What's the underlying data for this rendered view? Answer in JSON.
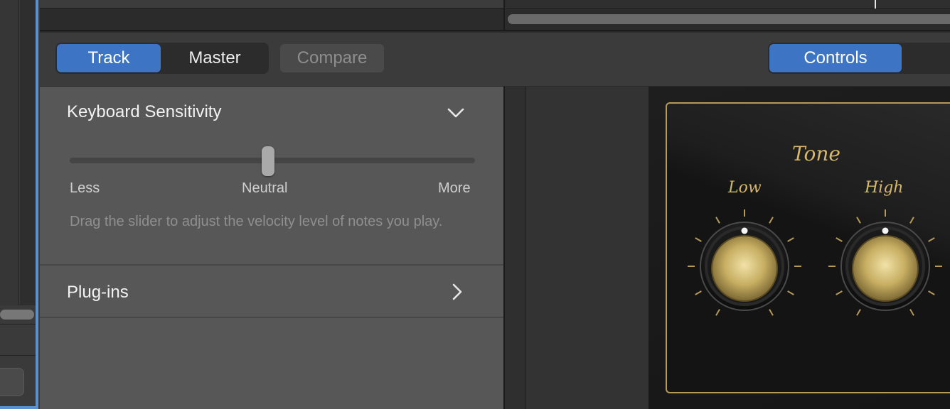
{
  "header": {
    "tabs": [
      {
        "label": "Track",
        "active": true
      },
      {
        "label": "Master",
        "active": false
      }
    ],
    "compare_label": "Compare",
    "view_tabs": [
      {
        "label": "Controls",
        "active": true
      }
    ]
  },
  "inspector": {
    "keyboard_sensitivity": {
      "title": "Keyboard Sensitivity",
      "slider_value": 0.5,
      "label_less": "Less",
      "label_neutral": "Neutral",
      "label_more": "More",
      "help_text": "Drag the slider to adjust the velocity level of notes you play."
    },
    "plugins": {
      "title": "Plug-ins"
    }
  },
  "plugin": {
    "section_title": "Tone",
    "knobs": [
      {
        "label": "Low",
        "value": 0.5
      },
      {
        "label": "High",
        "value": 0.5
      }
    ]
  },
  "colors": {
    "accent": "#3d75c4",
    "gold": "#d7b86a",
    "panel": "#575757"
  }
}
